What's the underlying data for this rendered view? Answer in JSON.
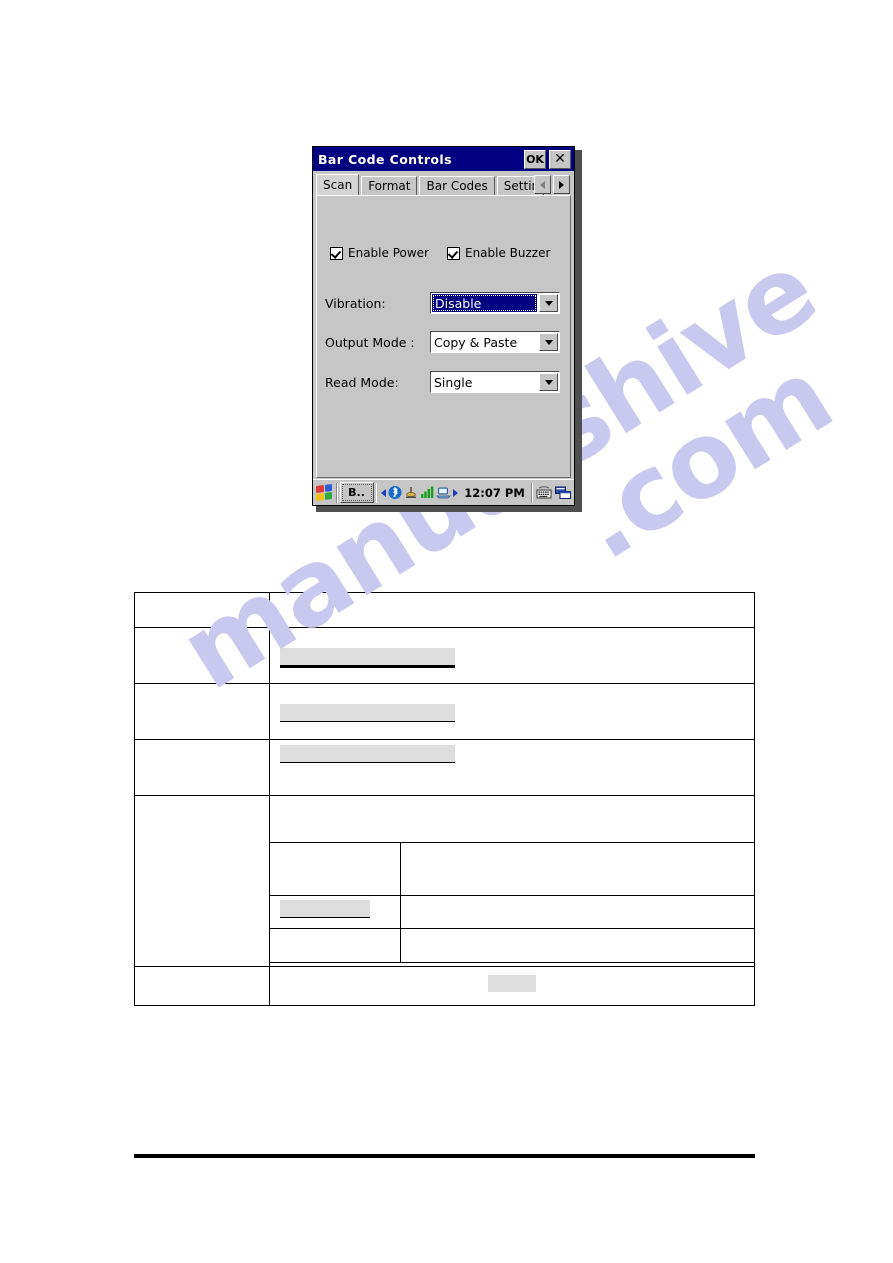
{
  "watermark": {
    "part1": "manualshive",
    "part2": ".com"
  },
  "window": {
    "title": "Bar Code Controls",
    "ok_label": "OK",
    "close_label": "✕",
    "tabs": [
      {
        "label": "Scan",
        "active": true
      },
      {
        "label": "Format",
        "active": false
      },
      {
        "label": "Bar Codes",
        "active": false
      },
      {
        "label": "Setting",
        "active": false
      }
    ],
    "tab_scroll": {
      "left_icon": "triangle-left-icon",
      "right_icon": "triangle-right-icon"
    },
    "checkboxes": [
      {
        "label": "Enable Power",
        "checked": true
      },
      {
        "label": "Enable Buzzer",
        "checked": true
      }
    ],
    "fields": [
      {
        "label": "Vibration:",
        "value": "Disable",
        "focused": true
      },
      {
        "label": "Output Mode :",
        "value": "Copy & Paste",
        "focused": false
      },
      {
        "label": "Read Mode:",
        "value": "Single",
        "focused": false
      }
    ],
    "taskbar": {
      "start_icon": "windows-flag-icon",
      "task_button": "B..",
      "tray_icons": [
        "triangle-left-icon",
        "bluetooth-icon",
        "antenna-icon",
        "signal-bars-icon",
        "network-pc-icon",
        "triangle-right-icon"
      ],
      "clock": "12:07 PM",
      "sip_icon": "keyboard-icon",
      "desktop_icon": "desktop-windows-icon"
    }
  },
  "table": {
    "rows": [
      {
        "left": "",
        "right": ""
      },
      {
        "left": "",
        "right": ""
      },
      {
        "left": "",
        "right": ""
      },
      {
        "left": "",
        "right": ""
      },
      {
        "left": "",
        "right": ""
      },
      {
        "left": "",
        "right": ""
      },
      {
        "left": "",
        "right": ""
      },
      {
        "left": "",
        "right": ""
      }
    ]
  },
  "colors": {
    "titlebar": "#000080",
    "chrome": "#c6c6c6",
    "highlight": "#000080",
    "watermark": "#c9c9ef",
    "redaction": "#dedede"
  }
}
